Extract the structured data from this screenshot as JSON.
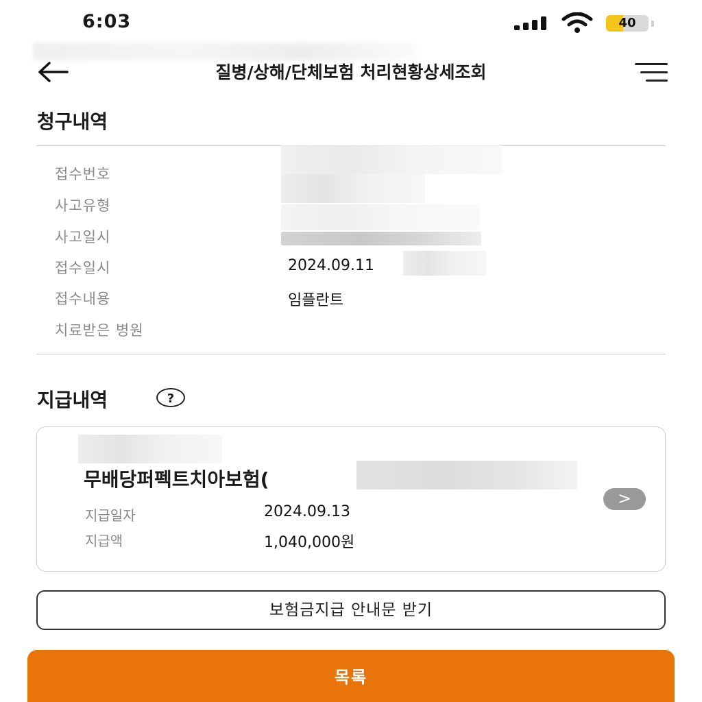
{
  "status_bar": {
    "time": "6:03",
    "battery_level": "40",
    "battery_fraction": 0.4
  },
  "header": {
    "title": "질병/상해/단체보험 처리현황상세조회",
    "back_icon": "arrow-left-icon",
    "menu_icon": "hamburger-menu-icon"
  },
  "claim_section": {
    "title": "청구내역",
    "rows": [
      {
        "label": "접수번호",
        "value": ""
      },
      {
        "label": "사고유형",
        "value": ""
      },
      {
        "label": "사고일시",
        "value": ""
      },
      {
        "label": "접수일시",
        "value": "2024.09.11"
      },
      {
        "label": "접수내용",
        "value": "임플란트"
      },
      {
        "label": "치료받은 병원",
        "value": ""
      }
    ]
  },
  "payment_section": {
    "title": "지급내역",
    "help_icon": "question-circle-icon",
    "help_glyph": "?",
    "card": {
      "product_name": "무배당퍼펙트치아보험(",
      "date_label": "지급일자",
      "date_value": "2024.09.13",
      "amount_label": "지급액",
      "amount_value": "1,040,000원",
      "chevron_icon": "chevron-right-icon",
      "chevron_glyph": ">"
    }
  },
  "buttons": {
    "notice_label": "보험금지급 안내문 받기",
    "list_label": "목록"
  },
  "colors": {
    "accent_orange": "#e8740a",
    "battery_yellow": "#f3c51b",
    "chevron_gray": "#999999",
    "label_gray": "#8a8a8a"
  }
}
